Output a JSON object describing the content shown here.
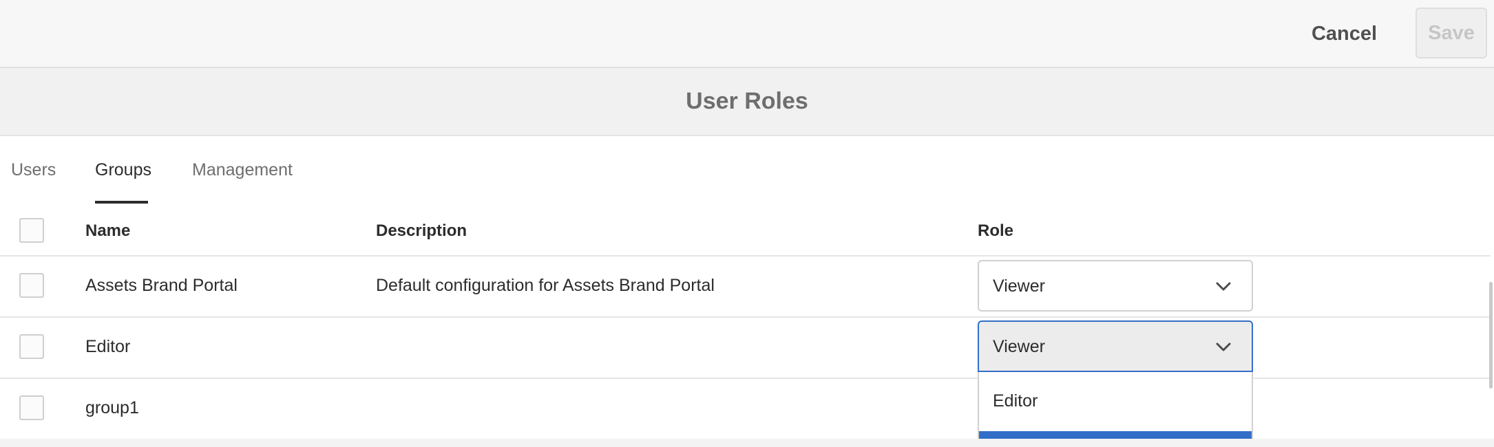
{
  "toolbar": {
    "cancel_label": "Cancel",
    "save_label": "Save"
  },
  "page": {
    "title": "User Roles"
  },
  "tabs": [
    {
      "label": "Users",
      "active": false
    },
    {
      "label": "Groups",
      "active": true
    },
    {
      "label": "Management",
      "active": false
    }
  ],
  "table": {
    "columns": [
      "Name",
      "Description",
      "Role"
    ],
    "rows": [
      {
        "name": "Assets Brand Portal",
        "description": "Default configuration for Assets Brand Portal",
        "role": "Viewer"
      },
      {
        "name": "Editor",
        "description": "",
        "role": "Viewer"
      },
      {
        "name": "group1",
        "description": "",
        "role": ""
      }
    ]
  },
  "dropdown": {
    "options": [
      "Editor"
    ]
  },
  "colors": {
    "accent": "#326ec8",
    "save_disabled_text": "#c6c6c6"
  },
  "icons": {
    "select_chevron": "chevron-down-icon"
  }
}
